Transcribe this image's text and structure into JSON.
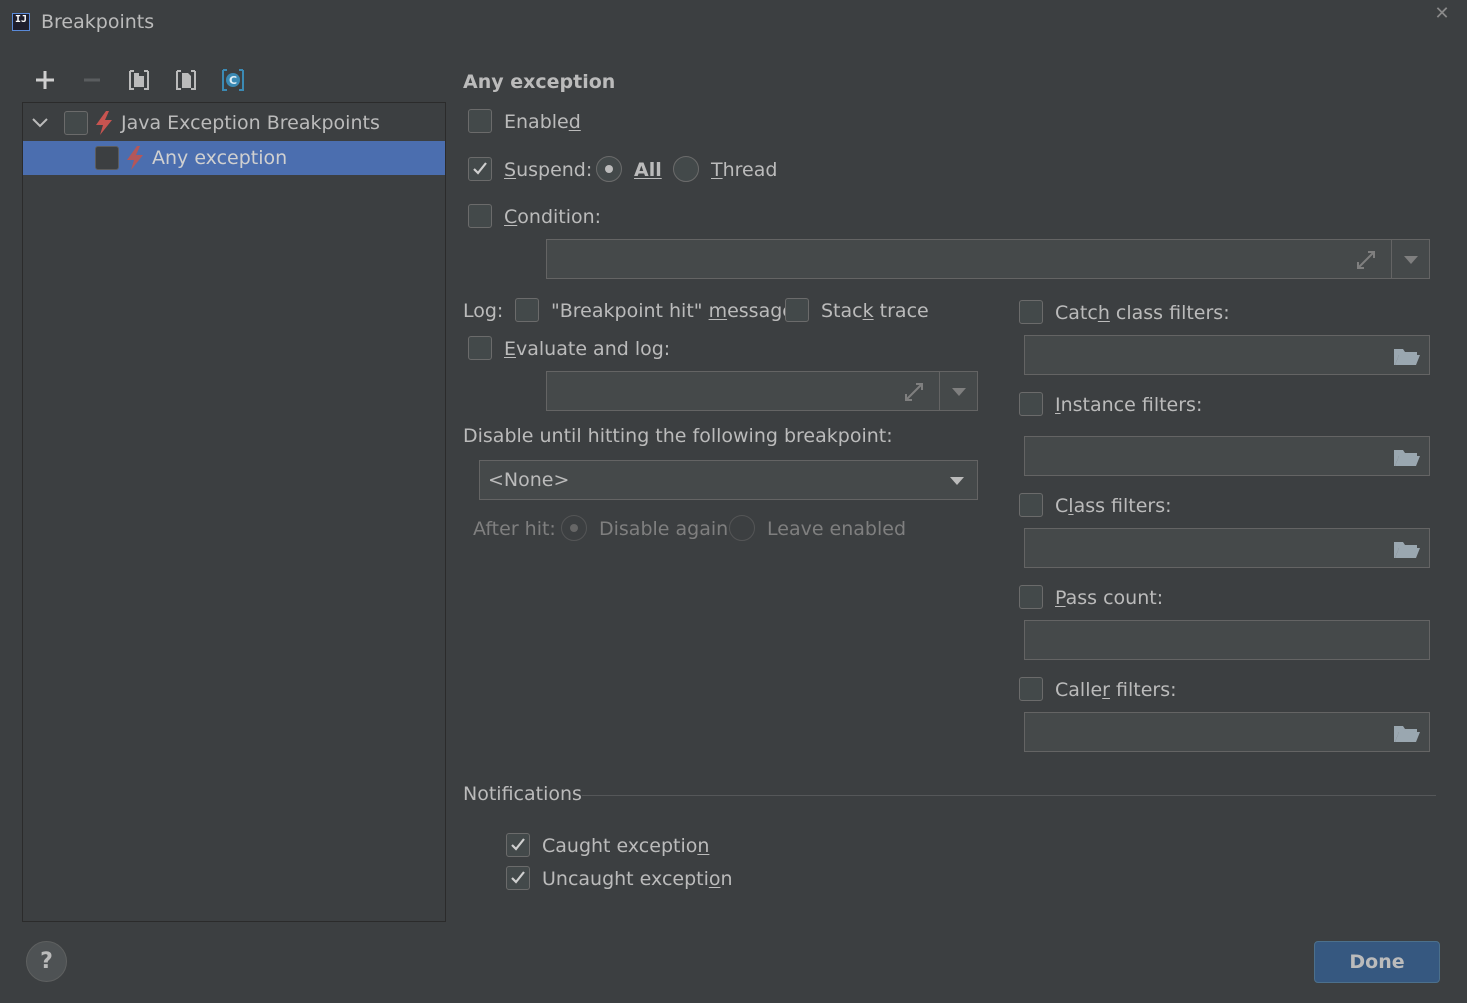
{
  "window": {
    "title": "Breakpoints"
  },
  "toolbar": {
    "items": [
      "add-icon",
      "remove-icon",
      "group-by-package-icon",
      "group-by-file-icon",
      "group-by-class-icon"
    ]
  },
  "tree": {
    "group": {
      "label": "Java Exception Breakpoints",
      "expanded": true,
      "checked": false
    },
    "item": {
      "label": "Any exception",
      "checked": false,
      "selected": true
    }
  },
  "details": {
    "heading": "Any exception",
    "enabled": {
      "label": "Enabled",
      "checked": false
    },
    "suspend": {
      "label": "Suspend:",
      "checked": true,
      "options": [
        "All",
        "Thread"
      ],
      "selected": "All"
    },
    "condition": {
      "label": "Condition:",
      "checked": false,
      "value": ""
    },
    "log": {
      "label": "Log:",
      "breakpoint_hit": {
        "label": "\"Breakpoint hit\" message",
        "checked": false
      },
      "stack_trace": {
        "label": "Stack trace",
        "checked": false
      }
    },
    "evaluate_and_log": {
      "label": "Evaluate and log:",
      "checked": false,
      "value": ""
    },
    "disable_until": {
      "label": "Disable until hitting the following breakpoint:",
      "value": "<None>"
    },
    "after_hit": {
      "label": "After hit:",
      "options": [
        "Disable again",
        "Leave enabled"
      ],
      "selected": "Disable again",
      "disabled": true
    },
    "catch_class_filters": {
      "label": "Catch class filters:",
      "checked": false,
      "value": ""
    },
    "instance_filters": {
      "label": "Instance filters:",
      "checked": false,
      "value": ""
    },
    "class_filters": {
      "label": "Class filters:",
      "checked": false,
      "value": ""
    },
    "pass_count": {
      "label": "Pass count:",
      "checked": false,
      "value": ""
    },
    "caller_filters": {
      "label": "Caller filters:",
      "checked": false,
      "value": ""
    },
    "notifications": {
      "label": "Notifications",
      "caught": {
        "label": "Caught exception",
        "checked": true
      },
      "uncaught": {
        "label": "Uncaught exception",
        "checked": true
      }
    }
  },
  "footer": {
    "help_label": "?",
    "done_label": "Done"
  },
  "colors": {
    "background": "#3c3f41",
    "selection": "#4b6eaf",
    "accent_button": "#365880",
    "breakpoint_red": "#c75450"
  }
}
